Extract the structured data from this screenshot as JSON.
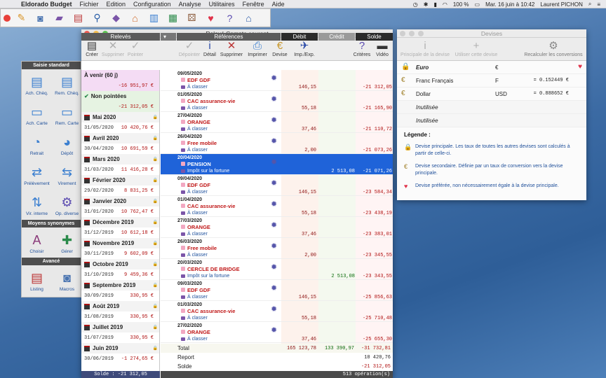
{
  "menubar": {
    "app": "Eldorado Budget",
    "items": [
      "Fichier",
      "Edition",
      "Configuration",
      "Analyse",
      "Utilitaires",
      "Fenêtre",
      "Aide"
    ],
    "status": "100 %",
    "datetime": "Mar. 16 juin à 10:42",
    "user": "Laurent PICHON"
  },
  "window": {
    "title": "Relevé Compte courant"
  },
  "toolbar": {
    "creer": "Créer",
    "supprimer": "Supprimer",
    "pointer": "Pointer",
    "depointer": "Dépointer",
    "detail": "Détail",
    "supprimer2": "Supprimer",
    "imprimer": "Imprimer",
    "devise": "Devise",
    "impexp": "Imp./Exp.",
    "criteres": "Critères",
    "video": "Vidéo"
  },
  "columns": {
    "releves": "Relevés",
    "references": "Références",
    "debit": "Débit",
    "credit": "Crédit",
    "solde": "Solde"
  },
  "sidebar": {
    "h1": "Saisie standard",
    "b1": "Ach. Chèq.",
    "b2": "Rem. Chèq.",
    "b3": "Ach. Carte",
    "b4": "Rem. Carte",
    "b5": "Retrait",
    "b6": "Dépôt",
    "b7": "Prélèvement",
    "b8": "Virement",
    "b9": "Vir. interne",
    "b10": "Op. diverse",
    "h2": "Moyens synonymes",
    "b11": "Choisir",
    "b12": "Gérer",
    "h3": "Avancé",
    "b13": "Listing",
    "b14": "Macros"
  },
  "releves": [
    {
      "label": "À venir (60 j)",
      "amount": "-16 951,97 €"
    },
    {
      "label": "Non pointées",
      "amount": "-21 312,05 €"
    },
    {
      "label": "Mai 2020",
      "date": "31/05/2020",
      "amount": "10 420,76 €"
    },
    {
      "label": "Avril 2020",
      "date": "30/04/2020",
      "amount": "10 691,59 €"
    },
    {
      "label": "Mars 2020",
      "date": "31/03/2020",
      "amount": "11 416,28 €"
    },
    {
      "label": "Février 2020",
      "date": "29/02/2020",
      "amount": "8 831,25 €"
    },
    {
      "label": "Janvier 2020",
      "date": "31/01/2020",
      "amount": "10 762,47 €"
    },
    {
      "label": "Décembre 2019",
      "date": "31/12/2019",
      "amount": "10 612,18 €"
    },
    {
      "label": "Novembre 2019",
      "date": "30/11/2019",
      "amount": "9 602,09 €"
    },
    {
      "label": "Octobre 2019",
      "date": "31/10/2019",
      "amount": "9 459,36 €"
    },
    {
      "label": "Septembre 2019",
      "date": "30/09/2019",
      "amount": "330,95 €"
    },
    {
      "label": "Août 2019",
      "date": "31/08/2019",
      "amount": "330,95 €"
    },
    {
      "label": "Juillet 2019",
      "date": "31/07/2019",
      "amount": "330,95 €"
    },
    {
      "label": "Juin 2019",
      "date": "30/06/2019",
      "amount": "-1 274,65 €"
    }
  ],
  "ops": [
    {
      "date": "09/05/2020",
      "name": "EDF GDF",
      "cat": "À classer",
      "debit": "146,15",
      "credit": "",
      "solde": "-21 312,05"
    },
    {
      "date": "01/05/2020",
      "name": "CAC assurance-vie",
      "cat": "À classer",
      "debit": "55,18",
      "credit": "",
      "solde": "-21 165,90"
    },
    {
      "date": "27/04/2020",
      "name": "ORANGE",
      "cat": "À classer",
      "debit": "37,46",
      "credit": "",
      "solde": "-21 110,72"
    },
    {
      "date": "26/04/2020",
      "name": "Free mobile",
      "cat": "À classer",
      "debit": "2,00",
      "credit": "",
      "solde": "-21 073,26"
    },
    {
      "date": "20/04/2020",
      "name": "PENSION",
      "cat": "Impôt sur la fortune",
      "debit": "",
      "credit": "2 513,08",
      "solde": "-21 071,26"
    },
    {
      "date": "09/04/2020",
      "name": "EDF GDF",
      "cat": "À classer",
      "debit": "146,15",
      "credit": "",
      "solde": "-23 584,34"
    },
    {
      "date": "01/04/2020",
      "name": "CAC assurance-vie",
      "cat": "À classer",
      "debit": "55,18",
      "credit": "",
      "solde": "-23 438,19"
    },
    {
      "date": "27/03/2020",
      "name": "ORANGE",
      "cat": "À classer",
      "debit": "37,46",
      "credit": "",
      "solde": "-23 383,01"
    },
    {
      "date": "26/03/2020",
      "name": "Free mobile",
      "cat": "À classer",
      "debit": "2,00",
      "credit": "",
      "solde": "-23 345,55"
    },
    {
      "date": "20/03/2020",
      "name": "CERCLE DE BRIDGE",
      "cat": "Impôt sur la fortune",
      "debit": "",
      "credit": "2 513,08",
      "solde": "-23 343,55"
    },
    {
      "date": "09/03/2020",
      "name": "EDF GDF",
      "cat": "À classer",
      "debit": "146,15",
      "credit": "",
      "solde": "-25 856,63"
    },
    {
      "date": "01/03/2020",
      "name": "CAC assurance-vie",
      "cat": "À classer",
      "debit": "55,18",
      "credit": "",
      "solde": "-25 710,48"
    },
    {
      "date": "27/02/2020",
      "name": "ORANGE",
      "cat": "À classer",
      "debit": "37,46",
      "credit": "",
      "solde": "-25 655,30"
    }
  ],
  "totals": {
    "total_label": "Total",
    "total_debit": "165 123,78",
    "total_credit": "133 390,97",
    "total_solde": "-31 732,81",
    "report_label": "Report",
    "report_solde": "10 420,76",
    "solde_label": "Solde",
    "solde_solde": "-21 312,05"
  },
  "status": {
    "left": "Solde : -21 312,05",
    "right": "513 opération(s)"
  },
  "devises": {
    "title": "Devises",
    "t1": "Principale de la devise",
    "t2": "Utiliser cette devise",
    "t3": "Recalculer les conversions",
    "rows": [
      {
        "name": "Euro",
        "sym": "€",
        "rate": ""
      },
      {
        "name": "Franc Français",
        "sym": "F",
        "rate": "= 0.152449 €"
      },
      {
        "name": "Dollar",
        "sym": "USD",
        "rate": "= 0.888652 €"
      },
      {
        "name": "Inutilisée",
        "sym": "",
        "rate": ""
      },
      {
        "name": "Inutilisée",
        "sym": "",
        "rate": ""
      }
    ],
    "legend_title": "Légende :",
    "l1": "Devise principale. Les taux de toutes les autres devises sont calculés à partir de celle-ci.",
    "l2": "Devise secondaire. Définie par un taux de conversion vers la devise principale.",
    "l3": "Devise préférée, non nécessairement égale à la devise principale."
  }
}
